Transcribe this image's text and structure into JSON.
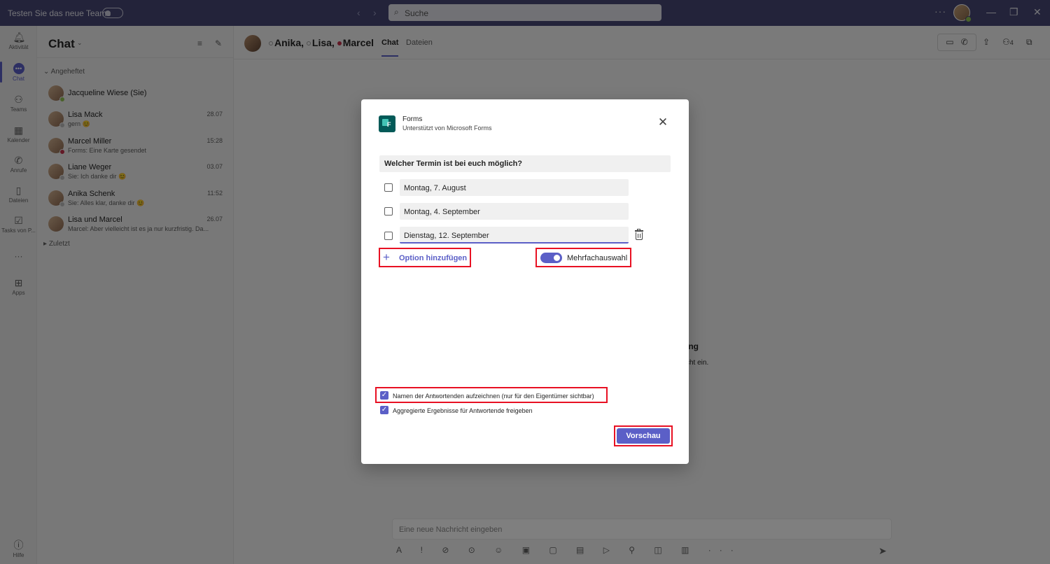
{
  "titlebar": {
    "try_new_teams": "Testen Sie das neue Teams",
    "search_placeholder": "Suche",
    "more": "···"
  },
  "rail": {
    "items": [
      {
        "label": "Aktivität",
        "icon": "bell-icon"
      },
      {
        "label": "Chat",
        "icon": "chat-icon"
      },
      {
        "label": "Teams",
        "icon": "teams-icon"
      },
      {
        "label": "Kalender",
        "icon": "calendar-icon"
      },
      {
        "label": "Anrufe",
        "icon": "phone-icon"
      },
      {
        "label": "Dateien",
        "icon": "file-icon"
      },
      {
        "label": "Tasks von P...",
        "icon": "tasks-icon"
      },
      {
        "label": "···",
        "icon": "more-icon"
      },
      {
        "label": "Apps",
        "icon": "apps-icon"
      },
      {
        "label": "Hilfe",
        "icon": "help-icon"
      }
    ]
  },
  "chatlist": {
    "title": "Chat",
    "pinned_label": "Angeheftet",
    "recent_label": "Zuletzt",
    "chats": [
      {
        "name": "Jacqueline Wiese (Sie)",
        "preview": "",
        "time": "",
        "status_color": "#92c353"
      },
      {
        "name": "Lisa Mack",
        "preview": "gern 😊",
        "time": "28.07",
        "status_color": "#bdbdbd"
      },
      {
        "name": "Marcel Miller",
        "preview": "Forms: Eine Karte gesendet",
        "time": "15:28",
        "status_color": "#c4314b"
      },
      {
        "name": "Liane Weger",
        "preview": "Sie: Ich danke dir 😊",
        "time": "03.07",
        "status_color": "#bdbdbd"
      },
      {
        "name": "Anika Schenk",
        "preview": "Sie: Alles klar, danke dir 😊",
        "time": "11:52",
        "status_color": "#bdbdbd"
      },
      {
        "name": "Lisa und Marcel",
        "preview": "Marcel: Aber vielleicht ist es ja nur kurzfristig. Da...",
        "time": "26.07",
        "status_color": ""
      }
    ]
  },
  "main": {
    "participants": [
      "Anika,",
      "Lisa,",
      "Marcel"
    ],
    "tabs": [
      "Chat",
      "Dateien"
    ],
    "people_count": "4",
    "compose_placeholder": "Eine neue Nachricht eingeben",
    "bg_fragment_1": "altung",
    "bg_fragment_2": "cht ein."
  },
  "dialog": {
    "app_name": "Forms",
    "subtitle": "Unterstützt von Microsoft Forms",
    "question": "Welcher Termin ist bei euch möglich?",
    "options": [
      "Montag, 7. August",
      "Montag, 4. September",
      "Dienstag, 12. September"
    ],
    "add_option_label": "Option hinzufügen",
    "multi_select_label": "Mehrfachauswahl",
    "multi_select_on": true,
    "record_names_label": "Namen der Antwortenden aufzeichnen (nur für den Eigentümer sichtbar)",
    "record_names_checked": true,
    "share_results_label": "Aggregierte Ergebnisse für Antwortende freigeben",
    "share_results_checked": true,
    "preview_button": "Vorschau"
  },
  "colors": {
    "accent": "#5b5fc7",
    "titlebar": "#464775",
    "highlight": "#e81123",
    "forms_brand": "#035a58"
  }
}
